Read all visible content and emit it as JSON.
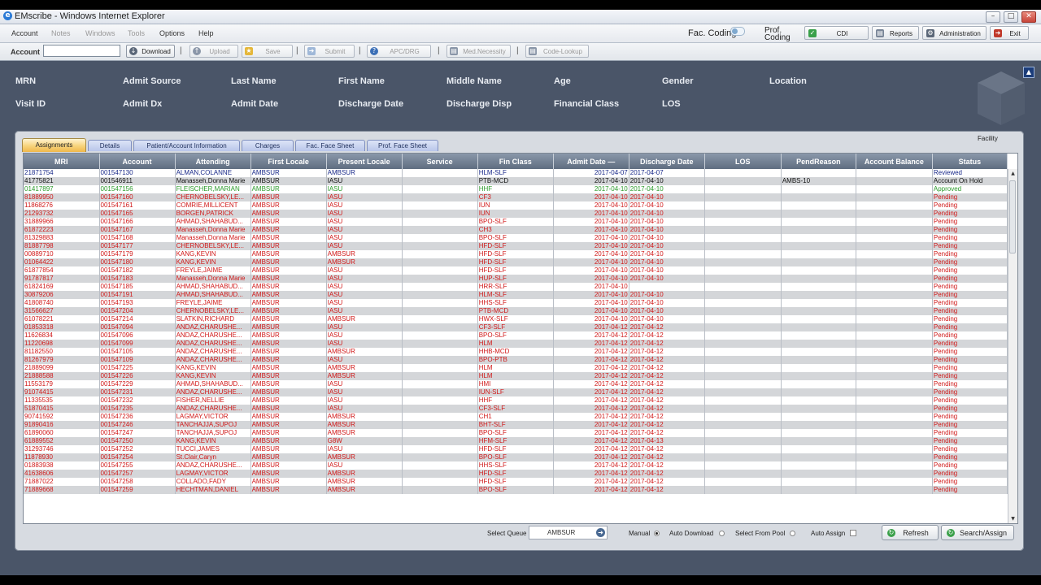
{
  "window": {
    "title": "EMscribe - Windows Internet Explorer"
  },
  "menu": {
    "items": [
      "Account",
      "Notes",
      "Windows",
      "Tools",
      "Options",
      "Help"
    ],
    "fac_coding": "Fac. Coding",
    "prof_coding": "Prof. Coding",
    "cdi": "CDI",
    "reports": "Reports",
    "administration": "Administration",
    "exit": "Exit"
  },
  "toolbar": {
    "account_label": "Account",
    "account_value": "",
    "download": "Download",
    "upload": "Upload",
    "save": "Save",
    "submit": "Submit",
    "apc_drg": "APC/DRG",
    "med_necessity": "Med.Necessity",
    "code_lookup": "Code-Lookup",
    "separator": "|"
  },
  "header_fields": {
    "row1": [
      "MRN",
      "Admit Source",
      "Last Name",
      "First Name",
      "Middle Name",
      "Age",
      "Gender",
      "Location"
    ],
    "row2": [
      "Visit ID",
      "Admit Dx",
      "Admit Date",
      "Discharge Date",
      "Discharge Disp",
      "Financial Class",
      "LOS"
    ]
  },
  "panel": {
    "facility_label": "Facility",
    "tabs": [
      "Assignments",
      "Details",
      "Patient/Account Information",
      "Charges",
      "Fac. Face Sheet",
      "Prof. Face Sheet"
    ],
    "active_tab": 0
  },
  "grid": {
    "columns": [
      "MRI",
      "Account",
      "Attending",
      "First Locale",
      "Present Locale",
      "Service",
      "Fin Class",
      "Admit Date —",
      "Discharge Date",
      "LOS",
      "PendReason",
      "Account Balance",
      "Status"
    ],
    "rows": [
      [
        "21871754",
        "001547130",
        "ALMAN,COLANNE",
        "AMBSUR",
        "AMBSUR",
        "",
        "HLM-SLF",
        "2017-04-07",
        "2017-04-07",
        "",
        "",
        "",
        "Reviewed",
        "#1a2a8a"
      ],
      [
        "41775821",
        "001546911",
        "Manasseh,Donna Marie",
        "AMBSUR",
        "IASU",
        "",
        "PTB-MCD",
        "2017-04-10",
        "2017-04-10",
        "",
        "AMBS-10",
        "",
        "Account On Hold",
        "#111111"
      ],
      [
        "01417897",
        "001547156",
        "FLEISCHER,MARIAN",
        "AMBSUR",
        "IASU",
        "",
        "HHF",
        "2017-04-10",
        "2017-04-10",
        "",
        "",
        "",
        "Approved",
        "#2a9a2a"
      ],
      [
        "81889950",
        "001547160",
        "CHERNOBELSKY,LE...",
        "AMBSUR",
        "IASU",
        "",
        "CF3",
        "2017-04-10",
        "2017-04-10",
        "",
        "",
        "",
        "Pending",
        "#d01818"
      ],
      [
        "11868276",
        "001547161",
        "COMRIE,MILLICENT",
        "AMBSUR",
        "IASU",
        "",
        "IUN",
        "2017-04-10",
        "2017-04-10",
        "",
        "",
        "",
        "Pending",
        "#d01818"
      ],
      [
        "21293732",
        "001547165",
        "BORGEN,PATRICK",
        "AMBSUR",
        "IASU",
        "",
        "IUN",
        "2017-04-10",
        "2017-04-10",
        "",
        "",
        "",
        "Pending",
        "#d01818"
      ],
      [
        "31889966",
        "001547166",
        "AHMAD,SHAHABUD...",
        "AMBSUR",
        "IASU",
        "",
        "BPO-SLF",
        "2017-04-10",
        "2017-04-10",
        "",
        "",
        "",
        "Pending",
        "#d01818"
      ],
      [
        "61872223",
        "001547167",
        "Manasseh,Donna Marie",
        "AMBSUR",
        "IASU",
        "",
        "CH3",
        "2017-04-10",
        "2017-04-10",
        "",
        "",
        "",
        "Pending",
        "#d01818"
      ],
      [
        "81329883",
        "001547168",
        "Manasseh,Donna Marie",
        "AMBSUR",
        "IASU",
        "",
        "BPO-SLF",
        "2017-04-10",
        "2017-04-10",
        "",
        "",
        "",
        "Pending",
        "#d01818"
      ],
      [
        "81887798",
        "001547177",
        "CHERNOBELSKY,LE...",
        "AMBSUR",
        "IASU",
        "",
        "HFD-SLF",
        "2017-04-10",
        "2017-04-10",
        "",
        "",
        "",
        "Pending",
        "#d01818"
      ],
      [
        "00889710",
        "001547179",
        "KANG,KEVIN",
        "AMBSUR",
        "AMBSUR",
        "",
        "HFD-SLF",
        "2017-04-10",
        "2017-04-10",
        "",
        "",
        "",
        "Pending",
        "#d01818"
      ],
      [
        "01064422",
        "001547180",
        "KANG,KEVIN",
        "AMBSUR",
        "AMBSUR",
        "",
        "HFD-SLF",
        "2017-04-10",
        "2017-04-10",
        "",
        "",
        "",
        "Pending",
        "#d01818"
      ],
      [
        "61877854",
        "001547182",
        "FREYLE,JAIME",
        "AMBSUR",
        "IASU",
        "",
        "HFD-SLF",
        "2017-04-10",
        "2017-04-10",
        "",
        "",
        "",
        "Pending",
        "#d01818"
      ],
      [
        "91787817",
        "001547183",
        "Manasseh,Donna Marie",
        "AMBSUR",
        "IASU",
        "",
        "HUP-SLF",
        "2017-04-10",
        "2017-04-10",
        "",
        "",
        "",
        "Pending",
        "#d01818"
      ],
      [
        "61824169",
        "001547185",
        "AHMAD,SHAHABUD...",
        "AMBSUR",
        "IASU",
        "",
        "HRR-SLF",
        "2017-04-10",
        "",
        "",
        "",
        "",
        "Pending",
        "#d01818"
      ],
      [
        "30879206",
        "001547191",
        "AHMAD,SHAHABUD...",
        "AMBSUR",
        "IASU",
        "",
        "HLM-SLF",
        "2017-04-10",
        "2017-04-10",
        "",
        "",
        "",
        "Pending",
        "#d01818"
      ],
      [
        "41808740",
        "001547193",
        "FREYLE,JAIME",
        "AMBSUR",
        "IASU",
        "",
        "HHS-SLF",
        "2017-04-10",
        "2017-04-10",
        "",
        "",
        "",
        "Pending",
        "#d01818"
      ],
      [
        "31566627",
        "001547204",
        "CHERNOBELSKY,LE...",
        "AMBSUR",
        "IASU",
        "",
        "PTB-MCD",
        "2017-04-10",
        "2017-04-10",
        "",
        "",
        "",
        "Pending",
        "#d01818"
      ],
      [
        "61078221",
        "001547214",
        "SLATKIN,RICHARD",
        "AMBSUR",
        "AMBSUR",
        "",
        "HWX-SLF",
        "2017-04-10",
        "2017-04-10",
        "",
        "",
        "",
        "Pending",
        "#d01818"
      ],
      [
        "01853318",
        "001547094",
        "ANDAZ,CHARUSHE...",
        "AMBSUR",
        "IASU",
        "",
        "CF3-SLF",
        "2017-04-12",
        "2017-04-12",
        "",
        "",
        "",
        "Pending",
        "#d01818"
      ],
      [
        "11626834",
        "001547096",
        "ANDAZ,CHARUSHE...",
        "AMBSUR",
        "IASU",
        "",
        "BPO-SLF",
        "2017-04-12",
        "2017-04-12",
        "",
        "",
        "",
        "Pending",
        "#d01818"
      ],
      [
        "11220698",
        "001547099",
        "ANDAZ,CHARUSHE...",
        "AMBSUR",
        "IASU",
        "",
        "HLM",
        "2017-04-12",
        "2017-04-12",
        "",
        "",
        "",
        "Pending",
        "#d01818"
      ],
      [
        "81182550",
        "001547105",
        "ANDAZ,CHARUSHE...",
        "AMBSUR",
        "AMBSUR",
        "",
        "HHB-MCD",
        "2017-04-12",
        "2017-04-12",
        "",
        "",
        "",
        "Pending",
        "#d01818"
      ],
      [
        "81267979",
        "001547109",
        "ANDAZ,CHARUSHE...",
        "AMBSUR",
        "IASU",
        "",
        "BPO-PTB",
        "2017-04-12",
        "2017-04-12",
        "",
        "",
        "",
        "Pending",
        "#d01818"
      ],
      [
        "21889099",
        "001547225",
        "KANG,KEVIN",
        "AMBSUR",
        "AMBSUR",
        "",
        "HLM",
        "2017-04-12",
        "2017-04-12",
        "",
        "",
        "",
        "Pending",
        "#d01818"
      ],
      [
        "21888588",
        "001547226",
        "KANG,KEVIN",
        "AMBSUR",
        "AMBSUR",
        "",
        "HLM",
        "2017-04-12",
        "2017-04-12",
        "",
        "",
        "",
        "Pending",
        "#d01818"
      ],
      [
        "11553179",
        "001547229",
        "AHMAD,SHAHABUD...",
        "AMBSUR",
        "IASU",
        "",
        "HMI",
        "2017-04-12",
        "2017-04-12",
        "",
        "",
        "",
        "Pending",
        "#d01818"
      ],
      [
        "91074415",
        "001547231",
        "ANDAZ,CHARUSHE...",
        "AMBSUR",
        "IASU",
        "",
        "IUN-SLF",
        "2017-04-12",
        "2017-04-12",
        "",
        "",
        "",
        "Pending",
        "#d01818"
      ],
      [
        "11335535",
        "001547232",
        "FISHER,NELLIE",
        "AMBSUR",
        "IASU",
        "",
        "HHF",
        "2017-04-12",
        "2017-04-12",
        "",
        "",
        "",
        "Pending",
        "#d01818"
      ],
      [
        "51870415",
        "001547235",
        "ANDAZ,CHARUSHE...",
        "AMBSUR",
        "IASU",
        "",
        "CF3-SLF",
        "2017-04-12",
        "2017-04-12",
        "",
        "",
        "",
        "Pending",
        "#d01818"
      ],
      [
        "90741592",
        "001547236",
        "LAGMAY,VICTOR",
        "AMBSUR",
        "AMBSUR",
        "",
        "CH1",
        "2017-04-12",
        "2017-04-12",
        "",
        "",
        "",
        "Pending",
        "#d01818"
      ],
      [
        "91890416",
        "001547246",
        "TANCHAJJA,SUPOJ",
        "AMBSUR",
        "AMBSUR",
        "",
        "BHT-SLF",
        "2017-04-12",
        "2017-04-12",
        "",
        "",
        "",
        "Pending",
        "#d01818"
      ],
      [
        "61890060",
        "001547247",
        "TANCHAJJA,SUPOJ",
        "AMBSUR",
        "AMBSUR",
        "",
        "BPO-SLF",
        "2017-04-12",
        "2017-04-12",
        "",
        "",
        "",
        "Pending",
        "#d01818"
      ],
      [
        "61889552",
        "001547250",
        "KANG,KEVIN",
        "AMBSUR",
        "G8W",
        "",
        "HFM-SLF",
        "2017-04-12",
        "2017-04-13",
        "",
        "",
        "",
        "Pending",
        "#d01818"
      ],
      [
        "31293746",
        "001547252",
        "TUCCI,JAMES",
        "AMBSUR",
        "IASU",
        "",
        "HFD-SLF",
        "2017-04-12",
        "2017-04-12",
        "",
        "",
        "",
        "Pending",
        "#d01818"
      ],
      [
        "11878930",
        "001547254",
        "St.Clair,Caryn",
        "AMBSUR",
        "AMBSUR",
        "",
        "BPO-SLF",
        "2017-04-12",
        "2017-04-12",
        "",
        "",
        "",
        "Pending",
        "#d01818"
      ],
      [
        "01883938",
        "001547255",
        "ANDAZ,CHARUSHE...",
        "AMBSUR",
        "IASU",
        "",
        "HHS-SLF",
        "2017-04-12",
        "2017-04-12",
        "",
        "",
        "",
        "Pending",
        "#d01818"
      ],
      [
        "41638606",
        "001547257",
        "LAGMAY,VICTOR",
        "AMBSUR",
        "AMBSUR",
        "",
        "HFD-SLF",
        "2017-04-12",
        "2017-04-12",
        "",
        "",
        "",
        "Pending",
        "#d01818"
      ],
      [
        "71887022",
        "001547258",
        "COLLADO,FADY",
        "AMBSUR",
        "AMBSUR",
        "",
        "HFD-SLF",
        "2017-04-12",
        "2017-04-12",
        "",
        "",
        "",
        "Pending",
        "#d01818"
      ],
      [
        "71889668",
        "001547259",
        "HECHTMAN,DANIEL",
        "AMBSUR",
        "AMBSUR",
        "",
        "BPO-SLF",
        "2017-04-12",
        "2017-04-12",
        "",
        "",
        "",
        "Pending",
        "#d01818"
      ]
    ]
  },
  "bottom": {
    "select_queue_label": "Select Queue",
    "select_queue_value": "AMBSUR",
    "manual": "Manual",
    "auto_download": "Auto Download",
    "select_from_pool": "Select From Pool",
    "auto_assign": "Auto Assign",
    "refresh": "Refresh",
    "search_assign": "Search/Assign"
  },
  "colors": {
    "pending": "#d01818",
    "approved": "#2a9a2a",
    "reviewed": "#1a2a8a",
    "panel_bg": "#4a5568"
  },
  "icons": [
    "ie-icon",
    "cdi-check-icon",
    "reports-icon",
    "administration-gear-icon",
    "exit-icon",
    "download-icon",
    "upload-icon",
    "save-icon",
    "submit-icon",
    "help-icon",
    "clipboard-icon",
    "lookup-icon",
    "refresh-icon",
    "search-assign-icon",
    "queue-arrow-icon",
    "cube-logo-icon"
  ]
}
